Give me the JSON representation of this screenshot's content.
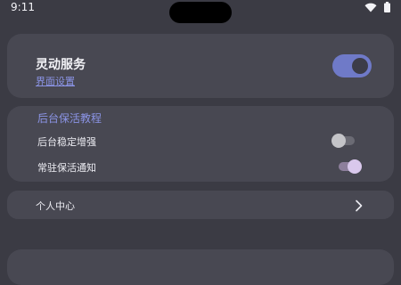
{
  "status_bar": {
    "time": "9:11",
    "icons": [
      "wifi-icon",
      "battery-icon"
    ]
  },
  "service_card": {
    "title": "灵动服务",
    "link": "界面设置",
    "switch_on": true
  },
  "tutorial_card": {
    "title": "后台保活教程",
    "items": [
      {
        "label": "后台稳定增强",
        "switch_on": false
      },
      {
        "label": "常驻保活通知",
        "switch_on": true
      }
    ]
  },
  "personal_center": {
    "label": "个人中心",
    "icon": "chevron-right-icon"
  },
  "colors": {
    "background": "#3b3b44",
    "card": "#484852",
    "accent": "#6f7ac8",
    "link": "#8b94e6"
  }
}
